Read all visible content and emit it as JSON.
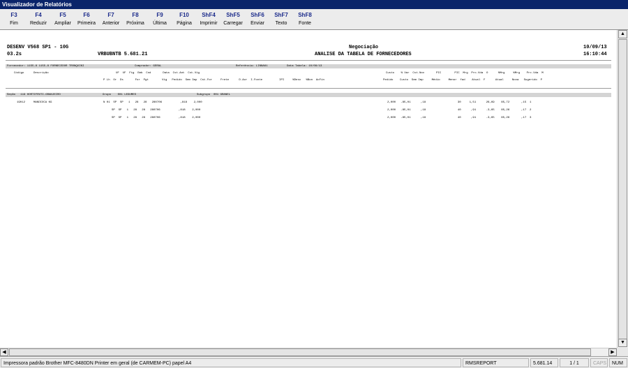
{
  "window": {
    "title": "Visualizador de Relatórios"
  },
  "function_keys": [
    {
      "key": "F3",
      "label": "Fim"
    },
    {
      "key": "F4",
      "label": "Reduzir"
    },
    {
      "key": "F5",
      "label": "Ampliar"
    },
    {
      "key": "F6",
      "label": "Primeira"
    },
    {
      "key": "F7",
      "label": "Anterior"
    },
    {
      "key": "F8",
      "label": "Próxima"
    },
    {
      "key": "F9",
      "label": "Última"
    },
    {
      "key": "F10",
      "label": "Página"
    },
    {
      "key": "ShF4",
      "label": "Imprimir"
    },
    {
      "key": "ShF5",
      "label": "Carregar"
    },
    {
      "key": "ShF6",
      "label": "Enviar"
    },
    {
      "key": "ShF7",
      "label": "Texto"
    },
    {
      "key": "ShF8",
      "label": "Fonte"
    }
  ],
  "report": {
    "system": "DESENV V568 SP1 - 10G",
    "version": "03.2s",
    "program": "VRBUBNTB 5.681.21",
    "title": "Negociação",
    "subtitle": "ANALISE DA TABELA DE FORNECEDORES",
    "date": "10/09/13",
    "time": "16:10:44",
    "filter": {
      "fornecedor": "Fornecedor: 1155-8 1155-8 FORNECEDOR TRONQUINI",
      "comprador": "Comprador: GERAL",
      "referencia": "Referência: LINNA61",
      "data_tabela": "Data Tabela: 10/08/13"
    },
    "col_header_1": {
      "codigo": "Código",
      "descricao": "Descrição",
      "mid": "UF  UF  Fig  Emb  Cnd       Data  Cst.Ant  Cst.Vig",
      "right": "Custo    % Var  Cst.Nov       PIC        PIC  Mrg  Prc.Vda  O      %Mrg     %Mrg    Prc.Vda  M"
    },
    "col_header_2": {
      "mid": "P Lh  Or  Ds       For  Pgt        Vig   Pedido  Sem Imp  Cst.For     Frete      D.Acr  I.Fonte          IPI     %Desc   %Bon  AcFin",
      "right": "Pedido    Custo  Sem Imp     Médio     Menor  fad    Atual  F      Atual     Nova   Sugerido  P"
    },
    "secao": {
      "secao": "Seção   119 HORTIFRUTI-GRANJEIRO",
      "grupo": "Grupo    001 LEGUMES",
      "subgrupo": "Subgrupo  001 GRANEL"
    },
    "rows": [
      {
        "codigo": "19012",
        "descricao": "MANDIOCA KG",
        "mid": "N 01  SP  SP   1   28   28   280706           ,818    2,000",
        "right": "2,000   -85,01      ,18                   30     1,51      26,69    85,72       ,15  1"
      },
      {
        "codigo": "",
        "descricao": "",
        "mid": "     SP  SP   1   28   28   280706           ,818    2,000",
        "right": "2,000   -85,01      ,18                   40      ,91      -3,65    85,26       ,17  2"
      },
      {
        "codigo": "",
        "descricao": "",
        "mid": "     SP  SP   1   28   28   280706           ,818    2,000",
        "right": "2,000   -85,01      ,18                   40      ,91      -3,65    85,26       ,17  3"
      }
    ]
  },
  "status": {
    "printer": "Impressora padrão Brother MFC-8480DN Printer em geral (de CARMEM-PC) papel A4",
    "module": "RMSREPORT",
    "version": "5.681.14",
    "page": "1 / 1",
    "caps": "CAPS",
    "num": "NUM"
  },
  "colors": {
    "title_bar": "#0a246a",
    "key_text": "#1a2a8a",
    "band": "#d4d4d4"
  }
}
